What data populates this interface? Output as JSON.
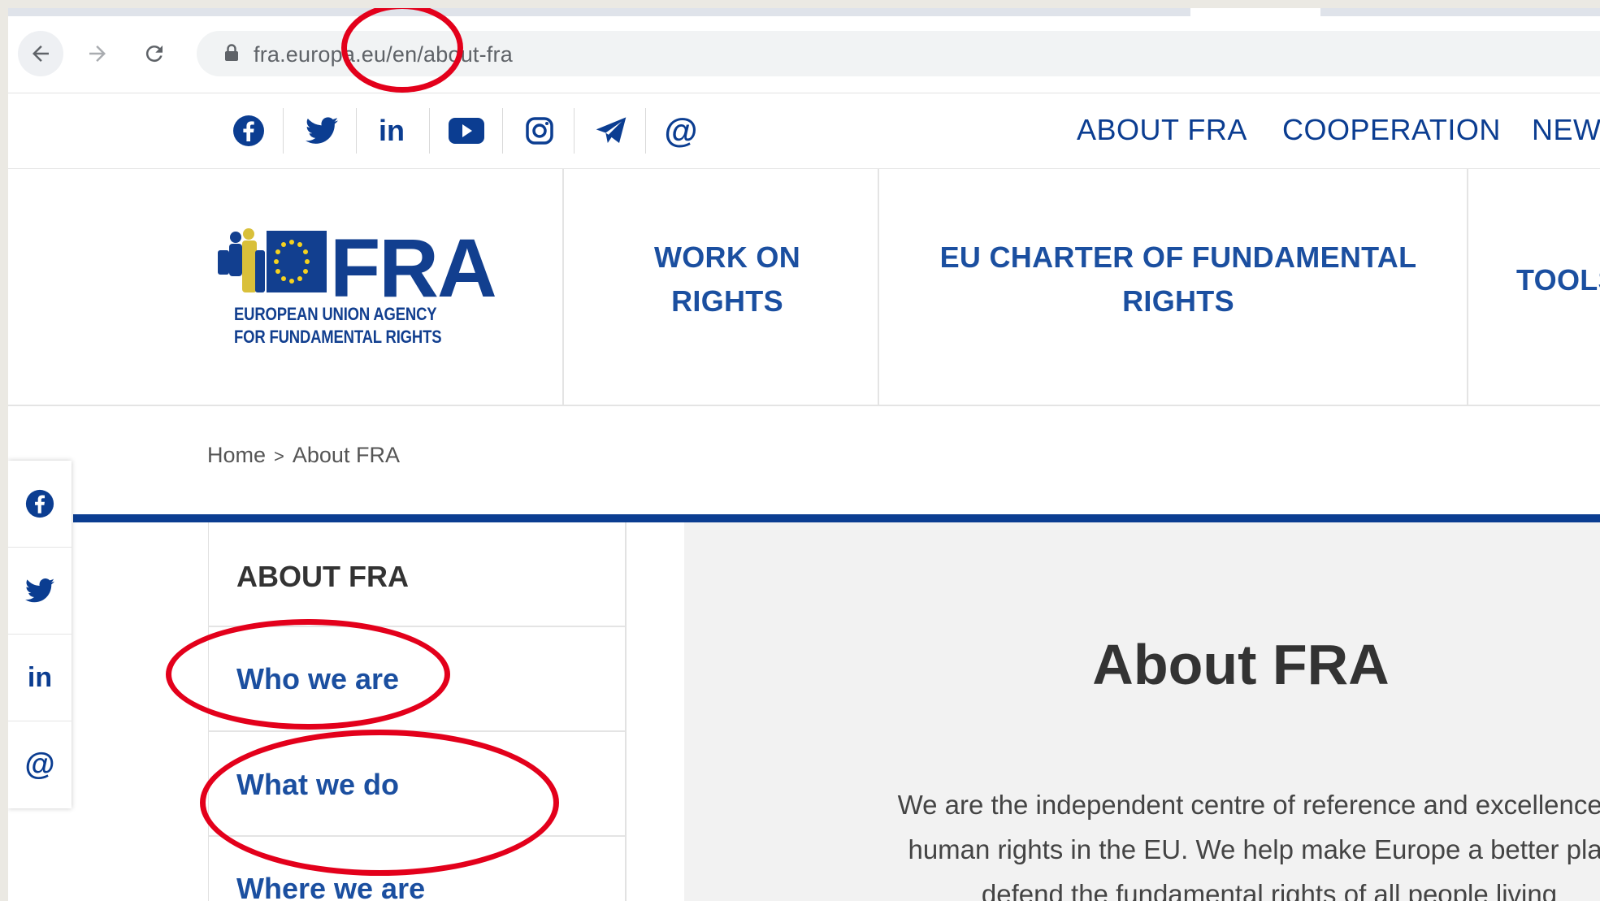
{
  "browser": {
    "url": "fra.europa.eu/en/about-fra"
  },
  "social_icons": [
    "facebook-icon",
    "twitter-icon",
    "linkedin-icon",
    "youtube-icon",
    "instagram-icon",
    "telegram-icon",
    "at-icon"
  ],
  "top_nav": [
    "ABOUT FRA",
    "COOPERATION",
    "NEWS"
  ],
  "logo": {
    "wordmark": "FRA",
    "line1": "EUROPEAN UNION AGENCY",
    "line2": "FOR FUNDAMENTAL RIGHTS"
  },
  "main_nav": [
    {
      "line1": "WORK ON",
      "line2": "RIGHTS"
    },
    {
      "line1": "EU CHARTER OF FUNDAMENTAL",
      "line2": "RIGHTS"
    },
    {
      "line1": "TOOLS",
      "line2": ""
    }
  ],
  "breadcrumb": {
    "home": "Home",
    "separator": ">",
    "current": "About FRA"
  },
  "side_share": [
    "facebook-icon",
    "twitter-icon",
    "linkedin-icon",
    "at-icon"
  ],
  "sidebar": {
    "heading": "ABOUT FRA",
    "items": [
      "Who we are",
      "What we do",
      "Where we are"
    ]
  },
  "content": {
    "title": "About FRA",
    "paragraph_lines": [
      "We are the independent centre of reference and excellence for",
      "human rights in the EU. We help make Europe a better place",
      "defend the fundamental rights of all people living"
    ]
  },
  "annotation_color": "#e3001b",
  "brand_color": "#0b3d91"
}
